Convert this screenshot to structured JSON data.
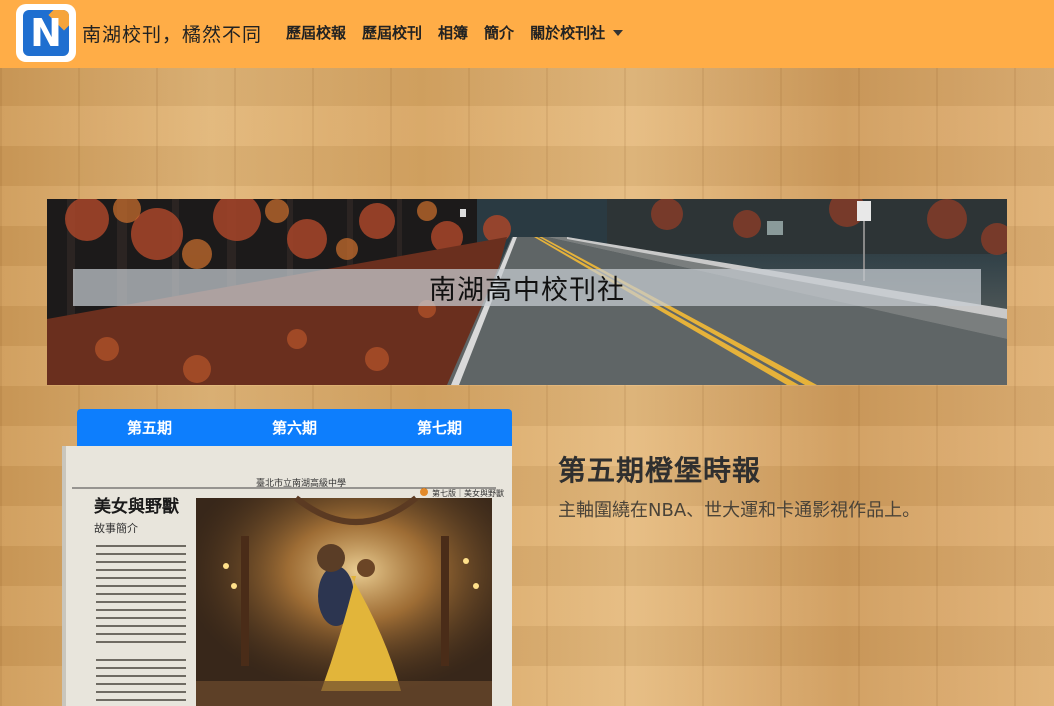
{
  "navbar": {
    "logo_icon": "n-logo-icon",
    "logo_letter": "N",
    "brand": "南湖校刊，橘然不同",
    "links": [
      {
        "label": "歷屆校報"
      },
      {
        "label": "歷屆校刊"
      },
      {
        "label": "相簿"
      },
      {
        "label": "簡介"
      },
      {
        "label": "關於校刊社",
        "has_dropdown": true,
        "icon": "caret-down-icon"
      }
    ]
  },
  "banner": {
    "title": "南湖高中校刊社",
    "image": "autumn-road-photo"
  },
  "issue_tabs": [
    "第五期",
    "第六期",
    "第七期"
  ],
  "paper": {
    "image": "newspaper-photo",
    "header_text": "臺北市立南湖高級中學",
    "header_right": "第七版｜美女與野獸",
    "headline": "美女與野獸",
    "subhead": "故事簡介"
  },
  "issue": {
    "heading": "第五期橙堡時報",
    "description": "主軸圍繞在NBA、世大運和卡通影視作品上。"
  },
  "colors": {
    "navbar": "#ffad47",
    "tabs": "#0d7efd",
    "logo_blue": "#1f6fd0"
  }
}
